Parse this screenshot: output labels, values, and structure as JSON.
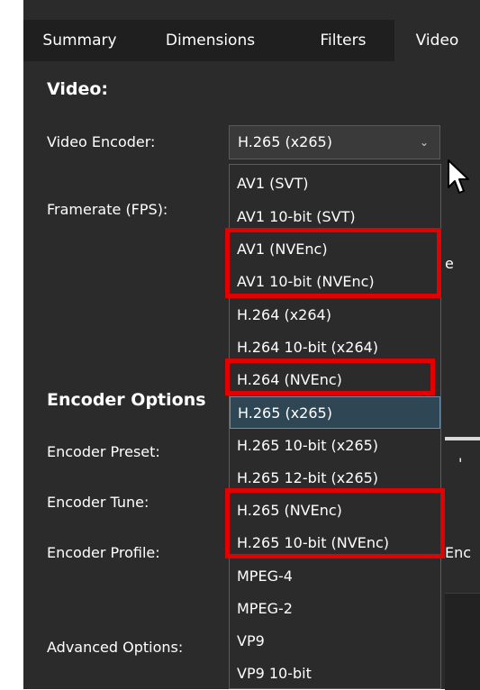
{
  "tabs": [
    "Summary",
    "Dimensions",
    "Filters",
    "Video"
  ],
  "video_section_title": "Video:",
  "labels": {
    "video_encoder": "Video Encoder:",
    "framerate": "Framerate (FPS):",
    "encoder_options": "Encoder Options",
    "encoder_preset": "Encoder Preset:",
    "encoder_tune": "Encoder Tune:",
    "encoder_profile": "Encoder Profile:",
    "advanced_options": "Advanced Options:"
  },
  "encoder_select": {
    "value": "H.265 (x265)",
    "icon": "chevron-down-icon"
  },
  "encoder_options": [
    "AV1 (SVT)",
    "AV1 10-bit (SVT)",
    "AV1 (NVEnc)",
    "AV1 10-bit (NVEnc)",
    "H.264 (x264)",
    "H.264 10-bit (x264)",
    "H.264 (NVEnc)",
    "H.265 (x265)",
    "H.265 10-bit (x265)",
    "H.265 12-bit (x265)",
    "H.265 (NVEnc)",
    "H.265 10-bit (NVEnc)",
    "MPEG-4",
    "MPEG-2",
    "VP9",
    "VP9 10-bit"
  ],
  "selected_option": "H.265 (x265)",
  "partial_text": {
    "right_e": "e",
    "right_enc": "Enc",
    "right_quote": "'"
  },
  "highlight_color": "#e30000",
  "icons": {
    "cursor": "mouse-pointer-icon"
  }
}
